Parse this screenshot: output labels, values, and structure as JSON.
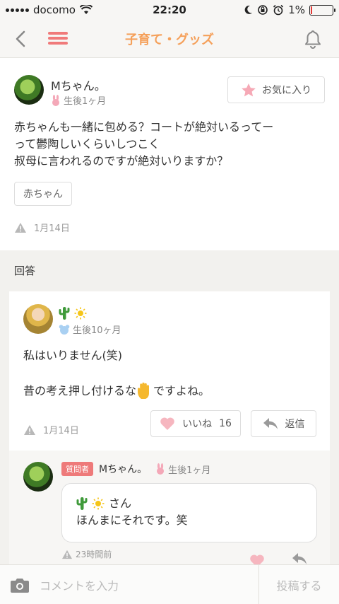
{
  "status_bar": {
    "carrier": "docomo",
    "time": "22:20",
    "battery": "1%"
  },
  "nav": {
    "title": "子育て・グッズ"
  },
  "question": {
    "author": "Mちゃん。",
    "age": "生後1ヶ月",
    "favorite_label": "お気に入り",
    "body_lines": [
      "赤ちゃんも一緒に包める？コートが絶対いるってー",
      "って鬱陶しいくらいしつこく",
      "叔母に言われるのですが絶対いりますか？"
    ],
    "tag": "赤ちゃん",
    "date": "1月14日"
  },
  "answers": {
    "heading": "回答",
    "items": [
      {
        "age": "生後10ヶ月",
        "body_line1": "私はいりません(笑)",
        "body_line2_before": "昔の考え押し付けるな",
        "body_line2_after": "ですよね。",
        "date": "1月14日",
        "like_label": "いいね",
        "like_count": "16",
        "reply_label": "返信",
        "reply": {
          "badge": "質問者",
          "author": "Mちゃん。",
          "age": "生後1ヶ月",
          "line1_suffix": "さん",
          "line2": "ほんまにそれです。笑",
          "time": "23時間前"
        }
      }
    ]
  },
  "comment_bar": {
    "placeholder": "コメントを入力",
    "post_label": "投稿する"
  },
  "colors": {
    "accent": "#f5a05a",
    "menu": "#f07a7a",
    "heart": "#f6b6bf",
    "badge": "#ee7a7a"
  }
}
